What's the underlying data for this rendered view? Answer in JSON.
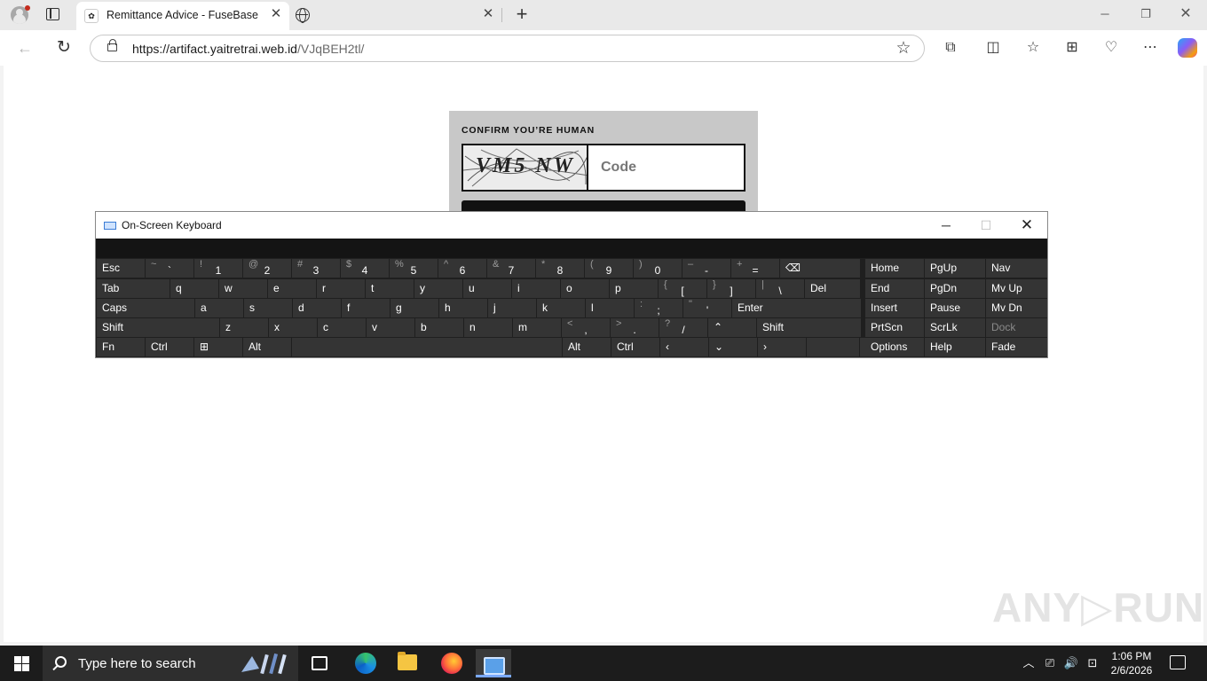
{
  "browser": {
    "tab": {
      "title": "Remittance Advice - FuseBase"
    },
    "address": {
      "host": "https://artifact.yaitretrai.web.id",
      "path": "/VJqBEH2tl/"
    }
  },
  "captcha": {
    "heading": "CONFIRM YOU’RE HUMAN",
    "image_text": "VM5 NW",
    "input_placeholder": "Code"
  },
  "watermark": "ANY▷RUN",
  "osk": {
    "title": "On-Screen Keyboard",
    "rows": [
      [
        {
          "label": "Esc",
          "w": 54
        },
        {
          "top": "~",
          "bot": "`"
        },
        {
          "top": "!",
          "bot": "1"
        },
        {
          "top": "@",
          "bot": "2"
        },
        {
          "top": "#",
          "bot": "3"
        },
        {
          "top": "$",
          "bot": "4"
        },
        {
          "top": "%",
          "bot": "5"
        },
        {
          "top": "^",
          "bot": "6"
        },
        {
          "top": "&",
          "bot": "7"
        },
        {
          "top": "*",
          "bot": "8"
        },
        {
          "top": "(",
          "bot": "9"
        },
        {
          "top": ")",
          "bot": "0"
        },
        {
          "top": "–",
          "bot": "-"
        },
        {
          "top": "+",
          "bot": "="
        },
        {
          "label": "⌫",
          "w": 90
        }
      ],
      [
        {
          "label": "Tab",
          "w": 82
        },
        {
          "label": "q"
        },
        {
          "label": "w"
        },
        {
          "label": "e"
        },
        {
          "label": "r"
        },
        {
          "label": "t"
        },
        {
          "label": "y"
        },
        {
          "label": "u"
        },
        {
          "label": "i"
        },
        {
          "label": "o"
        },
        {
          "label": "p"
        },
        {
          "top": "{",
          "bot": "["
        },
        {
          "top": "}",
          "bot": "]"
        },
        {
          "top": "|",
          "bot": "\\"
        },
        {
          "label": "Del",
          "w": 62
        }
      ],
      [
        {
          "label": "Caps",
          "w": 110
        },
        {
          "label": "a"
        },
        {
          "label": "s"
        },
        {
          "label": "d"
        },
        {
          "label": "f"
        },
        {
          "label": "g"
        },
        {
          "label": "h"
        },
        {
          "label": "j"
        },
        {
          "label": "k"
        },
        {
          "label": "l"
        },
        {
          "top": ":",
          "bot": ";"
        },
        {
          "top": "\"",
          "bot": "'"
        },
        {
          "label": "Enter",
          "w": 145
        }
      ],
      [
        {
          "label": "Shift",
          "w": 138
        },
        {
          "label": "z"
        },
        {
          "label": "x"
        },
        {
          "label": "c"
        },
        {
          "label": "v"
        },
        {
          "label": "b"
        },
        {
          "label": "n"
        },
        {
          "label": "m"
        },
        {
          "top": "<",
          "bot": ","
        },
        {
          "top": ">",
          "bot": "."
        },
        {
          "top": "?",
          "bot": "/"
        },
        {
          "label": "⌃"
        },
        {
          "label": "Shift",
          "w": 117
        }
      ],
      [
        {
          "label": "Fn"
        },
        {
          "label": "Ctrl"
        },
        {
          "label": "⊞"
        },
        {
          "label": "Alt"
        },
        {
          "label": "",
          "w": 304
        },
        {
          "label": "Alt"
        },
        {
          "label": "Ctrl"
        },
        {
          "label": "‹"
        },
        {
          "label": "⌄"
        },
        {
          "label": "›"
        },
        {
          "label": "",
          "w": 59
        },
        {
          "label": "▤"
        }
      ]
    ],
    "nav": [
      [
        "Home",
        "PgUp",
        "Nav"
      ],
      [
        "End",
        "PgDn",
        "Mv Up"
      ],
      [
        "Insert",
        "Pause",
        "Mv Dn"
      ],
      [
        "PrtScn",
        "ScrLk",
        "Dock"
      ],
      [
        "Options",
        "Help",
        "Fade"
      ]
    ]
  },
  "taskbar": {
    "search_placeholder": "Type here to search",
    "time": "1:06 PM",
    "date": "2/6/2026"
  }
}
